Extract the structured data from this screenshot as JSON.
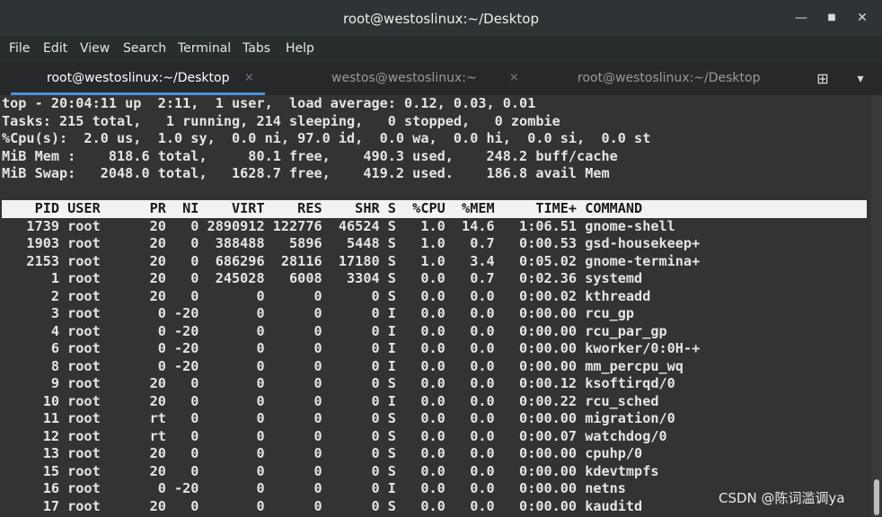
{
  "window": {
    "title": "root@westoslinux:~/Desktop",
    "minimize_glyph": "—",
    "maximize_glyph": "■",
    "close_glyph": "✕"
  },
  "menu": [
    "File",
    "Edit",
    "View",
    "Search",
    "Terminal",
    "Tabs",
    "Help"
  ],
  "tabs": [
    {
      "label": "root@westoslinux:~/Desktop",
      "active": true
    },
    {
      "label": "westos@westoslinux:~",
      "active": false
    },
    {
      "label": "root@westoslinux:~/Desktop",
      "active": false
    }
  ],
  "tab_close_glyph": "×",
  "tab_new_glyph": "⊞",
  "tab_menu_glyph": "▾",
  "summary": [
    "top - 20:04:11 up  2:11,  1 user,  load average: 0.12, 0.03, 0.01",
    "Tasks: 215 total,   1 running, 214 sleeping,   0 stopped,   0 zombie",
    "%Cpu(s):  2.0 us,  1.0 sy,  0.0 ni, 97.0 id,  0.0 wa,  0.0 hi,  0.0 si,  0.0 st",
    "MiB Mem :    818.6 total,     80.1 free,    490.3 used,    248.2 buff/cache",
    "MiB Swap:   2048.0 total,   1628.7 free,    419.2 used.    186.8 avail Mem"
  ],
  "header": "    PID USER      PR  NI    VIRT    RES    SHR S  %CPU  %MEM     TIME+ COMMAND",
  "processes": [
    "   1739 root      20   0 2890912 122776  46524 S   1.0  14.6   1:06.51 gnome-shell",
    "   1903 root      20   0  388488   5896   5448 S   1.0   0.7   0:00.53 gsd-housekeep+",
    "   2153 root      20   0  686296  28116  17180 S   1.0   3.4   0:05.02 gnome-termina+",
    "      1 root      20   0  245028   6008   3304 S   0.0   0.7   0:02.36 systemd",
    "      2 root      20   0       0      0      0 S   0.0   0.0   0:00.02 kthreadd",
    "      3 root       0 -20       0      0      0 I   0.0   0.0   0:00.00 rcu_gp",
    "      4 root       0 -20       0      0      0 I   0.0   0.0   0:00.00 rcu_par_gp",
    "      6 root       0 -20       0      0      0 I   0.0   0.0   0:00.00 kworker/0:0H-+",
    "      8 root       0 -20       0      0      0 I   0.0   0.0   0:00.00 mm_percpu_wq",
    "      9 root      20   0       0      0      0 S   0.0   0.0   0:00.12 ksoftirqd/0",
    "     10 root      20   0       0      0      0 I   0.0   0.0   0:00.22 rcu_sched",
    "     11 root      rt   0       0      0      0 S   0.0   0.0   0:00.00 migration/0",
    "     12 root      rt   0       0      0      0 S   0.0   0.0   0:00.07 watchdog/0",
    "     13 root      20   0       0      0      0 S   0.0   0.0   0:00.00 cpuhp/0",
    "     15 root      20   0       0      0      0 S   0.0   0.0   0:00.00 kdevtmpfs",
    "     16 root       0 -20       0      0      0 I   0.0   0.0   0:00.00 netns",
    "     17 root      20   0       0      0      0 S   0.0   0.0   0:00.00 kauditd"
  ],
  "watermark": "CSDN @陈词滥调ya"
}
